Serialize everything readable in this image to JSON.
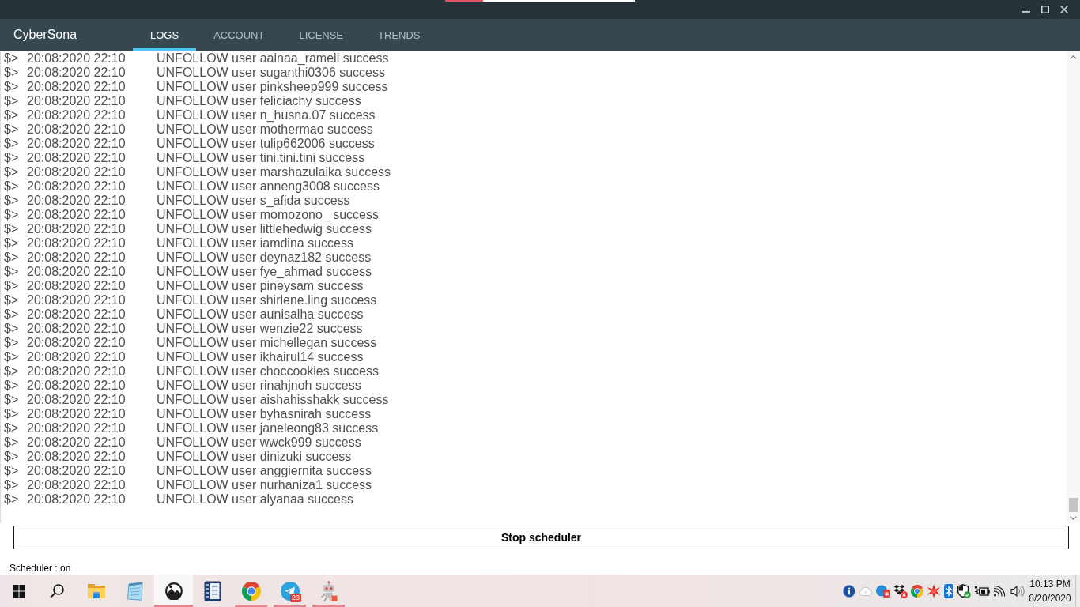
{
  "app": {
    "name": "CyberSona"
  },
  "tabs": [
    {
      "label": "LOGS",
      "selected": true
    },
    {
      "label": "ACCOUNT",
      "selected": false
    },
    {
      "label": "LICENSE",
      "selected": false
    },
    {
      "label": "TRENDS",
      "selected": false
    }
  ],
  "log": {
    "entries": [
      {
        "prompt": "$>",
        "time": "20:08:2020 22:10",
        "message": "UNFOLLOW user aainaa_rameli success"
      },
      {
        "prompt": "$>",
        "time": "20:08:2020 22:10",
        "message": "UNFOLLOW user suganthi0306 success"
      },
      {
        "prompt": "$>",
        "time": "20:08:2020 22:10",
        "message": "UNFOLLOW user pinksheep999 success"
      },
      {
        "prompt": "$>",
        "time": "20:08:2020 22:10",
        "message": "UNFOLLOW user feliciachy success"
      },
      {
        "prompt": "$>",
        "time": "20:08:2020 22:10",
        "message": "UNFOLLOW user n_husna.07 success"
      },
      {
        "prompt": "$>",
        "time": "20:08:2020 22:10",
        "message": "UNFOLLOW user mothermao success"
      },
      {
        "prompt": "$>",
        "time": "20:08:2020 22:10",
        "message": "UNFOLLOW user tulip662006 success"
      },
      {
        "prompt": "$>",
        "time": "20:08:2020 22:10",
        "message": "UNFOLLOW user tini.tini.tini success"
      },
      {
        "prompt": "$>",
        "time": "20:08:2020 22:10",
        "message": "UNFOLLOW user marshazulaika success"
      },
      {
        "prompt": "$>",
        "time": "20:08:2020 22:10",
        "message": "UNFOLLOW user anneng3008 success"
      },
      {
        "prompt": "$>",
        "time": "20:08:2020 22:10",
        "message": "UNFOLLOW user s_afida success"
      },
      {
        "prompt": "$>",
        "time": "20:08:2020 22:10",
        "message": "UNFOLLOW user momozono_ success"
      },
      {
        "prompt": "$>",
        "time": "20:08:2020 22:10",
        "message": "UNFOLLOW user littlehedwig success"
      },
      {
        "prompt": "$>",
        "time": "20:08:2020 22:10",
        "message": "UNFOLLOW user iamdina success"
      },
      {
        "prompt": "$>",
        "time": "20:08:2020 22:10",
        "message": "UNFOLLOW user deynaz182 success"
      },
      {
        "prompt": "$>",
        "time": "20:08:2020 22:10",
        "message": "UNFOLLOW user fye_ahmad success"
      },
      {
        "prompt": "$>",
        "time": "20:08:2020 22:10",
        "message": "UNFOLLOW user pineysam success"
      },
      {
        "prompt": "$>",
        "time": "20:08:2020 22:10",
        "message": "UNFOLLOW user shirlene.ling success"
      },
      {
        "prompt": "$>",
        "time": "20:08:2020 22:10",
        "message": "UNFOLLOW user aunisalha success"
      },
      {
        "prompt": "$>",
        "time": "20:08:2020 22:10",
        "message": "UNFOLLOW user wenzie22 success"
      },
      {
        "prompt": "$>",
        "time": "20:08:2020 22:10",
        "message": "UNFOLLOW user michellegan success"
      },
      {
        "prompt": "$>",
        "time": "20:08:2020 22:10",
        "message": "UNFOLLOW user ikhairul14 success"
      },
      {
        "prompt": "$>",
        "time": "20:08:2020 22:10",
        "message": "UNFOLLOW user choccookies success"
      },
      {
        "prompt": "$>",
        "time": "20:08:2020 22:10",
        "message": "UNFOLLOW user rinahjnoh success"
      },
      {
        "prompt": "$>",
        "time": "20:08:2020 22:10",
        "message": "UNFOLLOW user aishahisshakk success"
      },
      {
        "prompt": "$>",
        "time": "20:08:2020 22:10",
        "message": "UNFOLLOW user byhasnirah success"
      },
      {
        "prompt": "$>",
        "time": "20:08:2020 22:10",
        "message": "UNFOLLOW user janeleong83 success"
      },
      {
        "prompt": "$>",
        "time": "20:08:2020 22:10",
        "message": "UNFOLLOW user wwck999 success"
      },
      {
        "prompt": "$>",
        "time": "20:08:2020 22:10",
        "message": "UNFOLLOW user dinizuki success"
      },
      {
        "prompt": "$>",
        "time": "20:08:2020 22:10",
        "message": "UNFOLLOW user anggiernita success"
      },
      {
        "prompt": "$>",
        "time": "20:08:2020 22:10",
        "message": "UNFOLLOW user nurhaniza1 success"
      },
      {
        "prompt": "$>",
        "time": "20:08:2020 22:10",
        "message": "UNFOLLOW user alyanaa success"
      }
    ]
  },
  "actions": [
    {
      "label": "Stop scheduler"
    }
  ],
  "status_bar": {
    "text": "Scheduler : on"
  },
  "taskbar": {
    "apps": [
      {
        "running": false,
        "selected": false
      },
      {
        "running": false,
        "selected": false
      },
      {
        "running": true,
        "selected": true
      },
      {
        "running": false,
        "selected": false
      },
      {
        "running": true,
        "selected": false
      },
      {
        "running": true,
        "selected": false,
        "badge": "23"
      },
      {
        "running": true,
        "selected": false
      }
    ],
    "clock": {
      "time": "10:13 PM",
      "date": "8/20/2020"
    }
  }
}
